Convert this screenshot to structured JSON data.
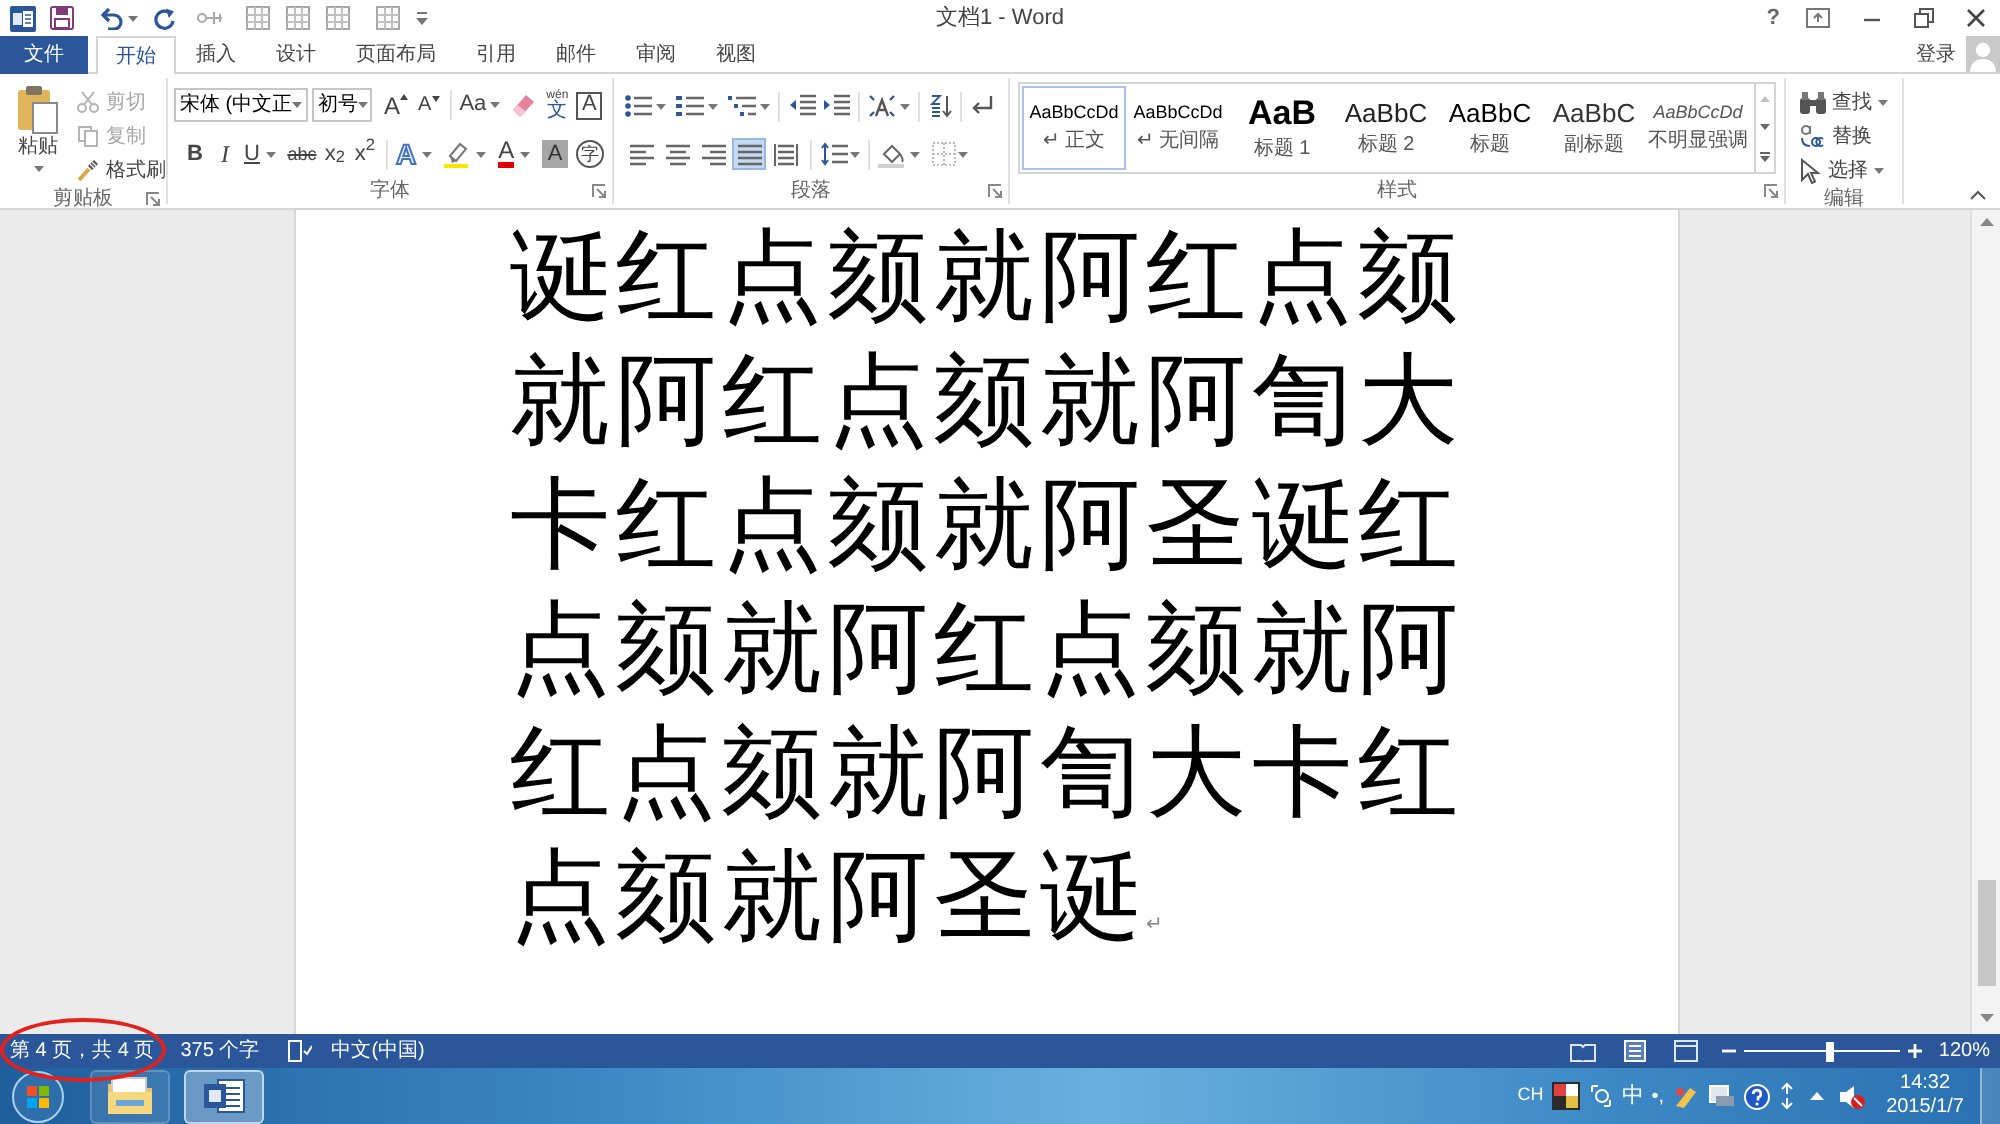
{
  "window": {
    "title": "文档1 - Word",
    "help": "?"
  },
  "tabs": [
    {
      "label": "文件",
      "kind": "file",
      "selected": false
    },
    {
      "label": "开始",
      "kind": "tab",
      "selected": true
    },
    {
      "label": "插入",
      "kind": "tab",
      "selected": false
    },
    {
      "label": "设计",
      "kind": "tab",
      "selected": false
    },
    {
      "label": "页面布局",
      "kind": "tab",
      "selected": false
    },
    {
      "label": "引用",
      "kind": "tab",
      "selected": false
    },
    {
      "label": "邮件",
      "kind": "tab",
      "selected": false
    },
    {
      "label": "审阅",
      "kind": "tab",
      "selected": false
    },
    {
      "label": "视图",
      "kind": "tab",
      "selected": false
    }
  ],
  "account": {
    "label": "登录"
  },
  "ribbon": {
    "clipboard": {
      "label": "剪贴板",
      "paste": "粘贴",
      "items": [
        {
          "label": "剪切",
          "disabled": true
        },
        {
          "label": "复制",
          "disabled": true
        },
        {
          "label": "格式刷",
          "disabled": false
        }
      ]
    },
    "font": {
      "label": "字体",
      "font_name": "宋体 (中文正",
      "font_size": "初号",
      "grow": "A",
      "shrink": "A",
      "change_case": "Aa",
      "phonetic_guide": {
        "ruby": "wén",
        "base": "文"
      },
      "char_border": "A",
      "bold": "B",
      "italic": "I",
      "underline": "U",
      "strikethrough": "abc",
      "subscript": "x$_{2}$",
      "superscript": "x$^{2}$",
      "text_effects": "A",
      "font_color": "A",
      "char_shading": "A",
      "enclose": "字"
    },
    "paragraph": {
      "label": "段落",
      "alignment": [
        {
          "kind": "left",
          "selected": false
        },
        {
          "kind": "center",
          "selected": false
        },
        {
          "kind": "right",
          "selected": false
        },
        {
          "kind": "justify",
          "selected": true
        },
        {
          "kind": "distribute",
          "selected": false
        }
      ]
    },
    "styles": {
      "label": "样式",
      "items": [
        {
          "preview": "AaBbCcDd",
          "name": "↵ 正文",
          "kind": "normal",
          "selected": true
        },
        {
          "preview": "AaBbCcDd",
          "name": "↵ 无间隔",
          "kind": "nospacing",
          "selected": false
        },
        {
          "preview": "AaB",
          "name": "标题 1",
          "kind": "heading1",
          "selected": false
        },
        {
          "preview": "AaBbC",
          "name": "标题 2",
          "kind": "heading2",
          "selected": false
        },
        {
          "preview": "AaBbC",
          "name": "标题",
          "kind": "title",
          "selected": false
        },
        {
          "preview": "AaBbC",
          "name": "副标题",
          "kind": "subtitle",
          "selected": false
        },
        {
          "preview": "AaBbCcDd",
          "name": "不明显强调",
          "kind": "subtle",
          "selected": false
        }
      ]
    },
    "editing": {
      "label": "编辑",
      "items": [
        {
          "label": "查找",
          "dropdown": true
        },
        {
          "label": "替换",
          "dropdown": false
        },
        {
          "label": "选择",
          "dropdown": true
        }
      ]
    }
  },
  "document": {
    "text": "诞红点颏就阿红点颏就阿红点颏就阿訇大卡红点颏就阿圣诞红点颏就阿红点颏就阿红点颏就阿訇大卡红点颏就阿圣诞",
    "end_mark": "↵"
  },
  "status_bar": {
    "items": [
      {
        "text": "第 4 页，共 4 页",
        "highlighted": true
      },
      {
        "text": "375 个字",
        "highlighted": false
      }
    ],
    "language": "中文(中国)",
    "zoom": {
      "level": 0.55,
      "reading": "120%"
    }
  },
  "taskbar": {
    "apps": [
      {
        "kind": "explorer",
        "selected": false
      },
      {
        "kind": "word",
        "selected": true
      }
    ],
    "tray": {
      "input_language": "CH",
      "ime_mode": "中",
      "punctuation": "•,",
      "time": "14:32",
      "date": "2015/1/7"
    }
  }
}
